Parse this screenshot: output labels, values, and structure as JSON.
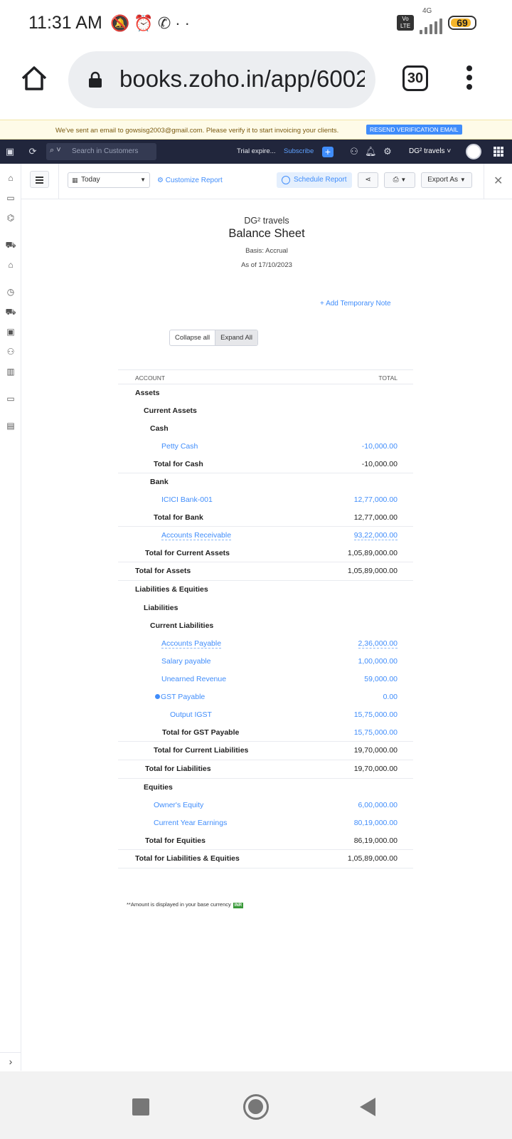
{
  "status_bar": {
    "time": "11:31 AM",
    "network": "4G",
    "battery": "69",
    "volte": "Vo LTE"
  },
  "browser": {
    "url": "books.zoho.in/app/6002",
    "tab_count": "30"
  },
  "banner": {
    "message": "We've sent an email to gowsisg2003@gmail.com. Please verify it to start invoicing your clients.",
    "button": "RESEND VERIFICATION EMAIL"
  },
  "topnav": {
    "search_placeholder": "Search in Customers",
    "trial": "Trial expire...",
    "subscribe": "Subscribe",
    "org": "DG² travels"
  },
  "toolbar": {
    "date": "Today",
    "customize": "Customize Report",
    "schedule": "Schedule Report",
    "export": "Export As"
  },
  "report": {
    "company": "DG² travels",
    "title": "Balance Sheet",
    "basis": "Basis: Accrual",
    "as_of": "As of 17/10/2023",
    "add_note": "+ Add Temporary Note",
    "collapse": "Collapse all",
    "expand": "Expand All",
    "col_account": "ACCOUNT",
    "col_total": "TOTAL",
    "footnote": "**Amount is displayed in your base currency",
    "currency": "INR"
  },
  "rows": [
    {
      "label": "Assets",
      "amount": ""
    },
    {
      "label": "Current Assets",
      "amount": ""
    },
    {
      "label": "Cash",
      "amount": ""
    },
    {
      "label": "Petty Cash",
      "amount": "-10,000.00"
    },
    {
      "label": "Total for Cash",
      "amount": "-10,000.00"
    },
    {
      "label": "Bank",
      "amount": ""
    },
    {
      "label": "ICICI Bank-001",
      "amount": "12,77,000.00"
    },
    {
      "label": "Total for Bank",
      "amount": "12,77,000.00"
    },
    {
      "label": "Accounts Receivable",
      "amount": "93,22,000.00"
    },
    {
      "label": "Total for Current Assets",
      "amount": "1,05,89,000.00"
    },
    {
      "label": "Total for Assets",
      "amount": "1,05,89,000.00"
    },
    {
      "label": "Liabilities & Equities",
      "amount": ""
    },
    {
      "label": "Liabilities",
      "amount": ""
    },
    {
      "label": "Current Liabilities",
      "amount": ""
    },
    {
      "label": "Accounts Payable",
      "amount": "2,36,000.00"
    },
    {
      "label": "Salary payable",
      "amount": "1,00,000.00"
    },
    {
      "label": "Unearned Revenue",
      "amount": "59,000.00"
    },
    {
      "label": "GST Payable",
      "amount": "0.00"
    },
    {
      "label": "Output IGST",
      "amount": "15,75,000.00"
    },
    {
      "label": "Total for GST Payable",
      "amount": "15,75,000.00"
    },
    {
      "label": "Total for Current Liabilities",
      "amount": "19,70,000.00"
    },
    {
      "label": "Total for Liabilities",
      "amount": "19,70,000.00"
    },
    {
      "label": "Equities",
      "amount": ""
    },
    {
      "label": "Owner's Equity",
      "amount": "6,00,000.00"
    },
    {
      "label": "Current Year Earnings",
      "amount": "80,19,000.00"
    },
    {
      "label": "Total for Equities",
      "amount": "86,19,000.00"
    },
    {
      "label": "Total for Liabilities & Equities",
      "amount": "1,05,89,000.00"
    }
  ]
}
